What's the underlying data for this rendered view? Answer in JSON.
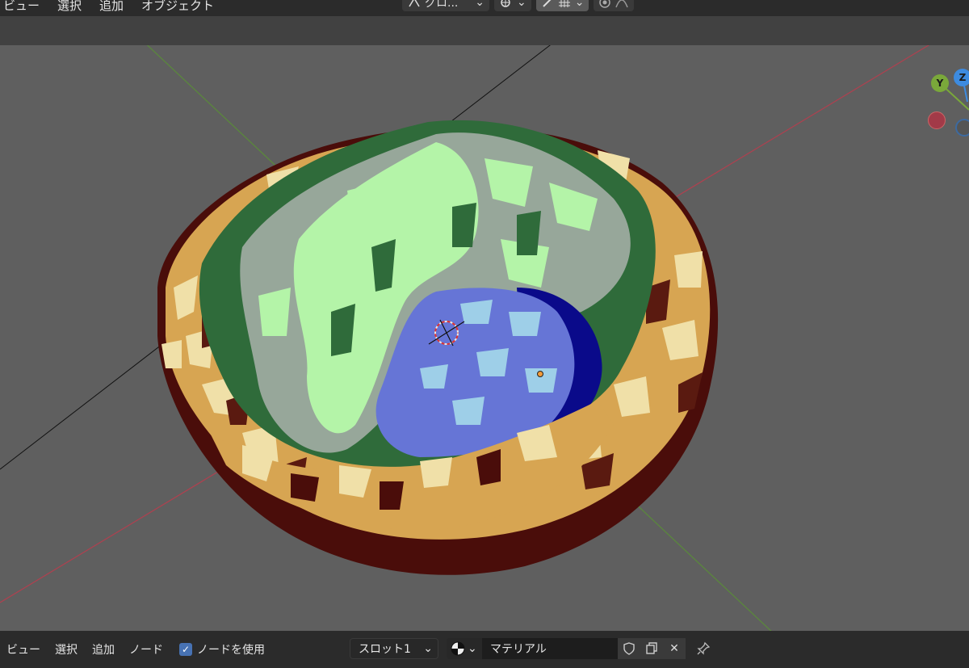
{
  "top_menu": [
    "ビュー",
    "選択",
    "追加",
    "オブジェクト"
  ],
  "top_toolbar": {
    "transform_orientation": "グロ...",
    "icons": [
      "transform-pivot-icon",
      "view-gizmo-icon",
      "snap-icon",
      "snap-increment-icon",
      "proportional-edit-icon",
      "falloff-icon"
    ]
  },
  "gizmo": {
    "y_label": "Y",
    "z_label": "Z"
  },
  "bottom_bar": {
    "menu": [
      "ビュー",
      "選択",
      "追加",
      "ノード"
    ],
    "use_nodes_label": "ノードを使用",
    "use_nodes_checked": true,
    "slot_label": "スロット1",
    "material_name": "マテリアル"
  },
  "colors": {
    "viewport_bg": "#5f5f5f",
    "x_axis": "#b0404f",
    "y_axis": "#5a8a3a",
    "rim_light": "#e8b861",
    "rim_dark": "#4a0d0a",
    "grass_light": "#b4f4a8",
    "grass_dark": "#2f6b3a",
    "rock_grey": "#97a79a",
    "water": "#6675d6",
    "water_light": "#9ecfe8",
    "water_deep": "#0a0a8a"
  }
}
